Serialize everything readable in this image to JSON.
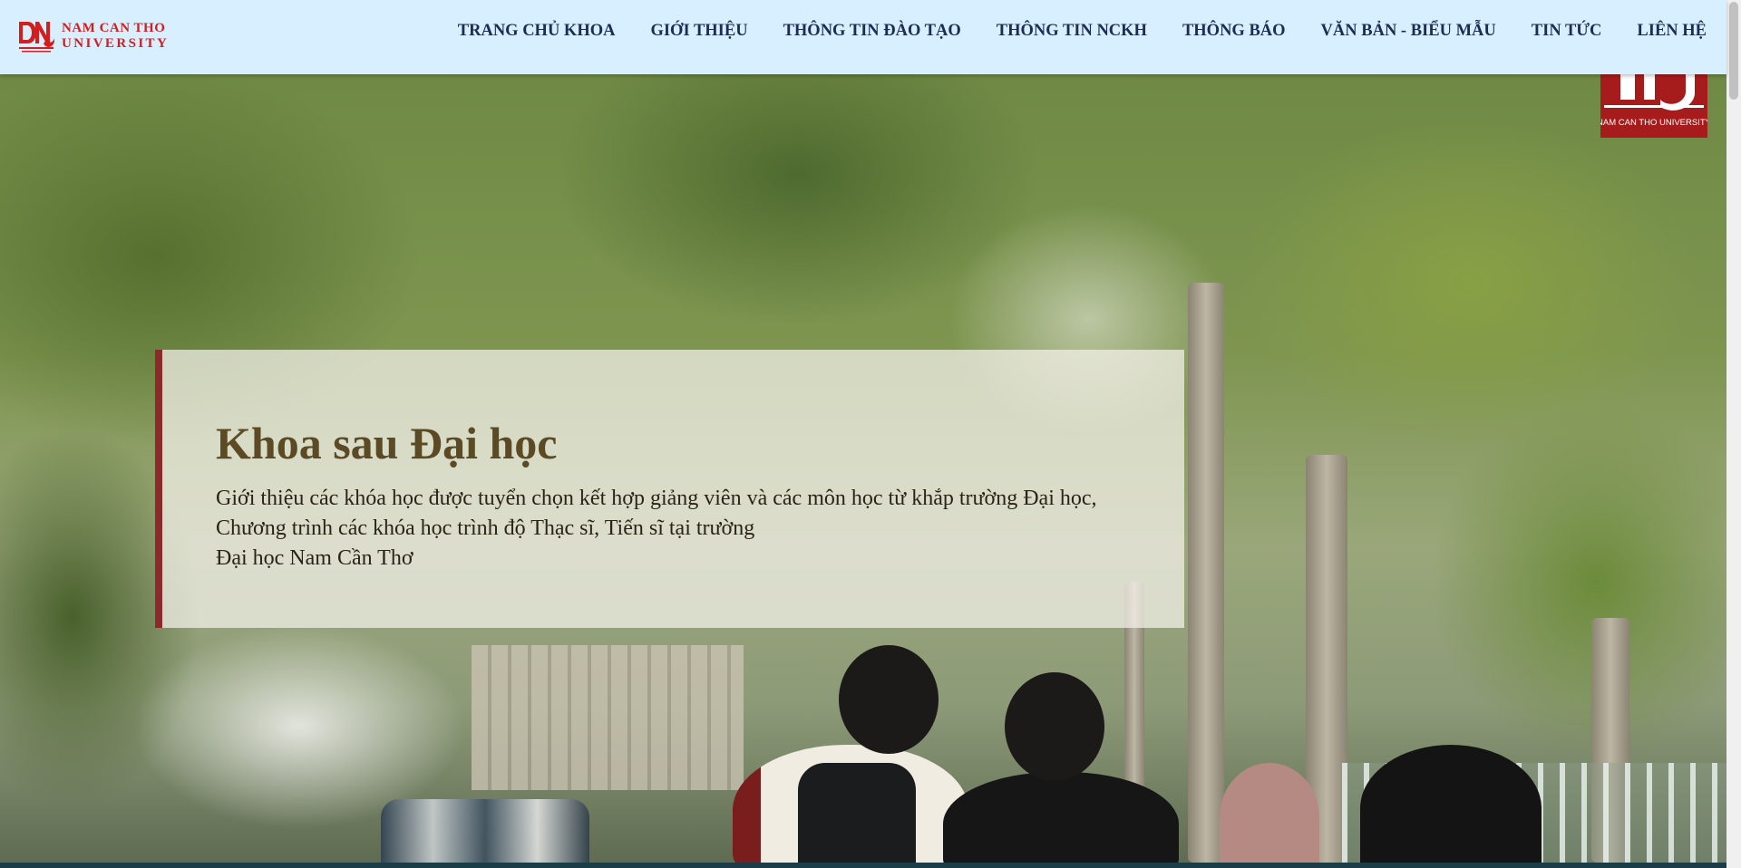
{
  "header": {
    "logo": {
      "mark": "DNC",
      "line1": "NAM CAN THO",
      "line2": "UNIVERSITY",
      "brand_color": "#d41d1d"
    },
    "nav": [
      {
        "label": "TRANG CHỦ KHOA"
      },
      {
        "label": "GIỚI THIỆU"
      },
      {
        "label": "THÔNG TIN ĐÀO TẠO"
      },
      {
        "label": "THÔNG TIN NCKH"
      },
      {
        "label": "THÔNG BÁO"
      },
      {
        "label": "VĂN BẢN - BIỂU MẪU"
      },
      {
        "label": "TIN TỨC"
      },
      {
        "label": "LIÊN HỆ"
      }
    ],
    "background": "#d7efff",
    "nav_color": "#1d2c55"
  },
  "hero": {
    "corner_logo": {
      "mark": "DNC",
      "caption": "NAM CAN THO UNIVERSITY",
      "color": "#a61c1c"
    },
    "title": "Khoa sau Đại học",
    "description": [
      "Giới thiệu các khóa học được tuyển chọn kết hợp giảng viên và các môn học từ khắp trường Đại học,",
      "Chương trình các khóa học trình độ Thạc sĩ, Tiến sĩ tại trường",
      "Đại học Nam Cần Thơ"
    ],
    "accent_color": "#8a2a2a",
    "title_color": "#5c4a24"
  }
}
